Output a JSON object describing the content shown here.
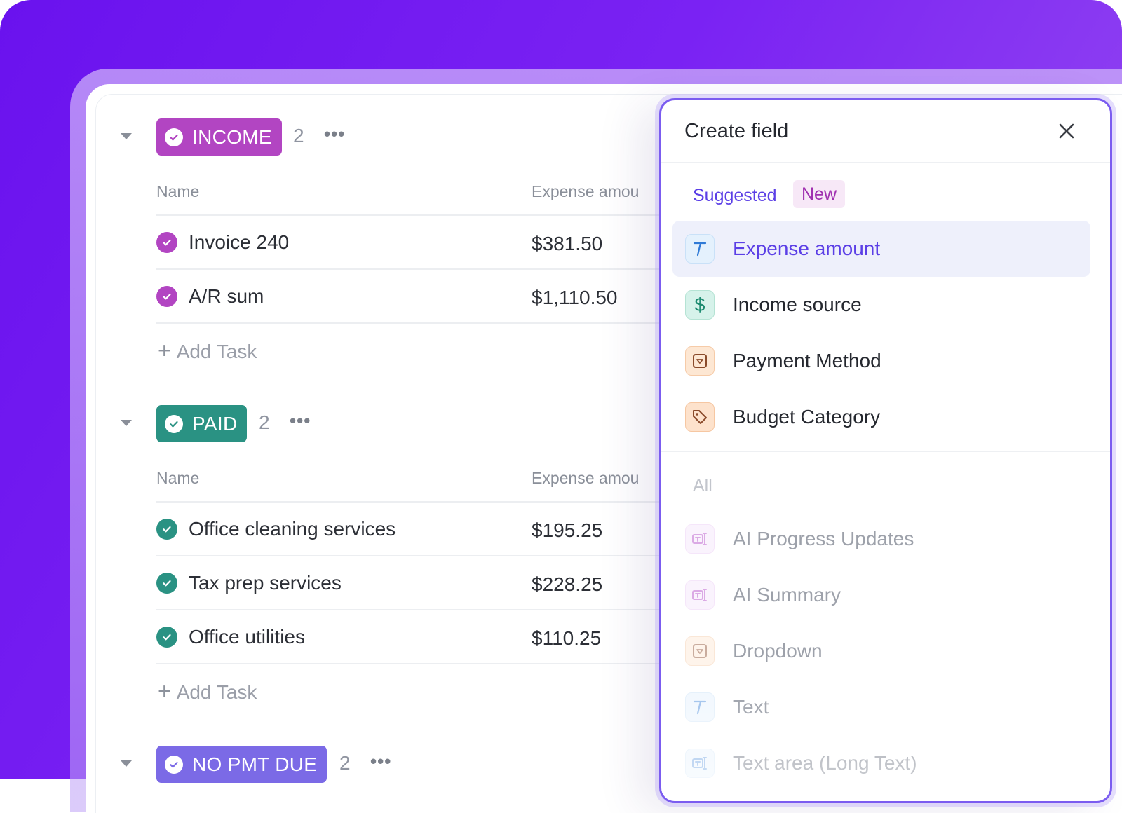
{
  "colors": {
    "income_badge": "#b245c2",
    "paid_badge": "#2a9283",
    "no_pmt_badge": "#7b6ae6",
    "accent": "#5b3fe6"
  },
  "list": {
    "groups": [
      {
        "badge_label": "INCOME",
        "count": "2",
        "more": "•••",
        "col_name": "Name",
        "col_amount": "Expense amou",
        "rows": [
          {
            "name": "Invoice 240",
            "amount": "$381.50"
          },
          {
            "name": "A/R sum",
            "amount": "$1,110.50"
          }
        ],
        "add_task": "Add Task"
      },
      {
        "badge_label": "PAID",
        "count": "2",
        "more": "•••",
        "col_name": "Name",
        "col_amount": "Expense amou",
        "rows": [
          {
            "name": "Office cleaning services",
            "amount": "$195.25"
          },
          {
            "name": "Tax prep services",
            "amount": "$228.25"
          },
          {
            "name": "Office utilities",
            "amount": "$110.25"
          }
        ],
        "add_task": "Add Task"
      },
      {
        "badge_label": "NO PMT DUE",
        "count": "2",
        "more": "•••"
      }
    ]
  },
  "create_field": {
    "title": "Create field",
    "close_icon": "close-icon",
    "suggested_label": "Suggested",
    "new_label": "New",
    "suggested": [
      {
        "label": "Expense amount",
        "icon": "text-type-icon"
      },
      {
        "label": "Income source",
        "icon": "dollar-icon"
      },
      {
        "label": "Payment Method",
        "icon": "dropdown-icon"
      },
      {
        "label": "Budget Category",
        "icon": "tag-icon"
      }
    ],
    "all_label": "All",
    "all": [
      {
        "label": "AI Progress Updates",
        "icon": "ai-field-icon"
      },
      {
        "label": "AI Summary",
        "icon": "ai-field-icon"
      },
      {
        "label": "Dropdown",
        "icon": "dropdown-icon"
      },
      {
        "label": "Text",
        "icon": "text-type-icon"
      },
      {
        "label": "Text area (Long Text)",
        "icon": "ai-field-icon"
      }
    ]
  }
}
